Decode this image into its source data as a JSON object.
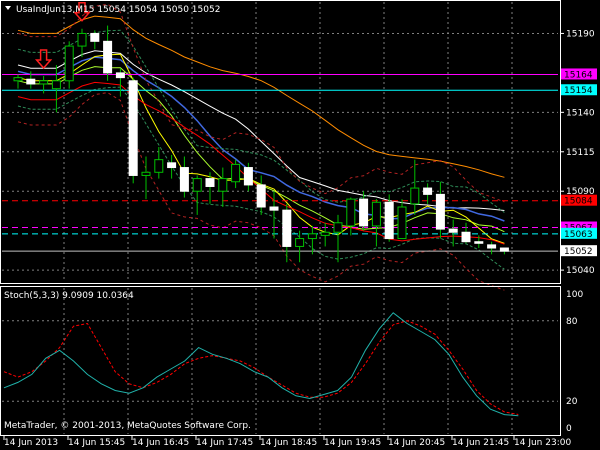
{
  "header": {
    "symbol_line": "UsaIndJun13,M15  15054 15054 15050 15052",
    "stoch_label": "Stoch(5,3,3) 9.0909 10.0364",
    "copyright": "MetaTrader, © 2001-2013, MetaQuotes Software Corp."
  },
  "colors": {
    "background": "#000000",
    "grid": "#808080",
    "bull_candle": "#ffffff",
    "bear_candle": "#ffffff",
    "wick": "#00c000",
    "stoch_main": "#20b2aa",
    "stoch_signal": "#ff0000",
    "magenta_line": "#ff00ff",
    "cyan_line": "#00ffff",
    "red_line": "#ff0000"
  },
  "price_axis": {
    "ticks": [
      "15190",
      "15154",
      "15140",
      "15115",
      "15090",
      "15063",
      "15040"
    ],
    "labels": [
      {
        "text": "15164",
        "bg": "#ff00ff",
        "fg": "#000000"
      },
      {
        "text": "15154",
        "bg": "#00ffff",
        "fg": "#000000"
      },
      {
        "text": "15084",
        "bg": "#ff0000",
        "fg": "#000000"
      },
      {
        "text": "15067",
        "bg": "#ff00ff",
        "fg": "#000000"
      },
      {
        "text": "15063",
        "bg": "#00ffff",
        "fg": "#000000"
      },
      {
        "text": "15052",
        "bg": "#ffffff",
        "fg": "#000000"
      }
    ]
  },
  "stoch_axis": {
    "ticks": [
      "100",
      "80",
      "20",
      "0"
    ]
  },
  "time_axis": {
    "labels": [
      "14 Jun 2013",
      "14 Jun 15:45",
      "14 Jun 16:45",
      "14 Jun 17:45",
      "14 Jun 18:45",
      "14 Jun 19:45",
      "14 Jun 20:45",
      "14 Jun 21:45",
      "14 Jun 23:00"
    ]
  },
  "chart_data": {
    "type": "candlestick",
    "symbol": "UsaIndJun13",
    "timeframe": "M15",
    "ylim": [
      15035,
      15215
    ],
    "candles": [
      {
        "o": 15160,
        "h": 15164,
        "l": 15155,
        "c": 15162
      },
      {
        "o": 15161,
        "h": 15166,
        "l": 15155,
        "c": 15158
      },
      {
        "o": 15158,
        "h": 15163,
        "l": 15152,
        "c": 15160
      },
      {
        "o": 15155,
        "h": 15170,
        "l": 15140,
        "c": 15160
      },
      {
        "o": 15160,
        "h": 15185,
        "l": 15155,
        "c": 15182
      },
      {
        "o": 15182,
        "h": 15193,
        "l": 15175,
        "c": 15190
      },
      {
        "o": 15190,
        "h": 15192,
        "l": 15180,
        "c": 15185
      },
      {
        "o": 15185,
        "h": 15195,
        "l": 15160,
        "c": 15165
      },
      {
        "o": 15165,
        "h": 15168,
        "l": 15150,
        "c": 15162
      },
      {
        "o": 15160,
        "h": 15162,
        "l": 15095,
        "c": 15100
      },
      {
        "o": 15100,
        "h": 15112,
        "l": 15085,
        "c": 15102
      },
      {
        "o": 15102,
        "h": 15118,
        "l": 15098,
        "c": 15110
      },
      {
        "o": 15108,
        "h": 15113,
        "l": 15098,
        "c": 15105
      },
      {
        "o": 15105,
        "h": 15112,
        "l": 15086,
        "c": 15090
      },
      {
        "o": 15090,
        "h": 15100,
        "l": 15075,
        "c": 15098
      },
      {
        "o": 15098,
        "h": 15102,
        "l": 15082,
        "c": 15093
      },
      {
        "o": 15090,
        "h": 15105,
        "l": 15080,
        "c": 15098
      },
      {
        "o": 15096,
        "h": 15110,
        "l": 15092,
        "c": 15107
      },
      {
        "o": 15105,
        "h": 15108,
        "l": 15090,
        "c": 15094
      },
      {
        "o": 15094,
        "h": 15100,
        "l": 15075,
        "c": 15080
      },
      {
        "o": 15080,
        "h": 15090,
        "l": 15060,
        "c": 15078
      },
      {
        "o": 15078,
        "h": 15082,
        "l": 15045,
        "c": 15055
      },
      {
        "o": 15055,
        "h": 15065,
        "l": 15045,
        "c": 15060
      },
      {
        "o": 15060,
        "h": 15068,
        "l": 15050,
        "c": 15063
      },
      {
        "o": 15062,
        "h": 15070,
        "l": 15055,
        "c": 15064
      },
      {
        "o": 15064,
        "h": 15075,
        "l": 15045,
        "c": 15070
      },
      {
        "o": 15068,
        "h": 15086,
        "l": 15062,
        "c": 15085
      },
      {
        "o": 15085,
        "h": 15090,
        "l": 15065,
        "c": 15068
      },
      {
        "o": 15068,
        "h": 15085,
        "l": 15055,
        "c": 15083
      },
      {
        "o": 15083,
        "h": 15088,
        "l": 15058,
        "c": 15060
      },
      {
        "o": 15060,
        "h": 15085,
        "l": 15060,
        "c": 15080
      },
      {
        "o": 15082,
        "h": 15110,
        "l": 15075,
        "c": 15092
      },
      {
        "o": 15092,
        "h": 15095,
        "l": 15082,
        "c": 15088
      },
      {
        "o": 15088,
        "h": 15096,
        "l": 15060,
        "c": 15066
      },
      {
        "o": 15066,
        "h": 15072,
        "l": 15055,
        "c": 15064
      },
      {
        "o": 15064,
        "h": 15070,
        "l": 15057,
        "c": 15058
      },
      {
        "o": 15058,
        "h": 15062,
        "l": 15054,
        "c": 15057
      },
      {
        "o": 15056,
        "h": 15058,
        "l": 15050,
        "c": 15054
      },
      {
        "o": 15054,
        "h": 15054,
        "l": 15050,
        "c": 15052
      }
    ],
    "stoch_main": [
      30,
      34,
      40,
      52,
      58,
      50,
      40,
      33,
      28,
      26,
      30,
      38,
      44,
      50,
      60,
      55,
      52,
      48,
      42,
      38,
      30,
      24,
      22,
      25,
      28,
      38,
      58,
      74,
      86,
      78,
      72,
      66,
      55,
      38,
      24,
      14,
      10,
      9.09
    ],
    "stoch_signal": [
      42,
      38,
      42,
      50,
      60,
      76,
      78,
      60,
      42,
      33,
      30,
      34,
      40,
      48,
      52,
      54,
      52,
      50,
      45,
      38,
      32,
      26,
      23,
      23,
      26,
      34,
      48,
      64,
      77,
      80,
      76,
      70,
      58,
      44,
      28,
      18,
      12,
      10.04
    ],
    "arrows": [
      {
        "type": "sell",
        "index": 2
      },
      {
        "type": "sell",
        "index": 5
      }
    ]
  }
}
